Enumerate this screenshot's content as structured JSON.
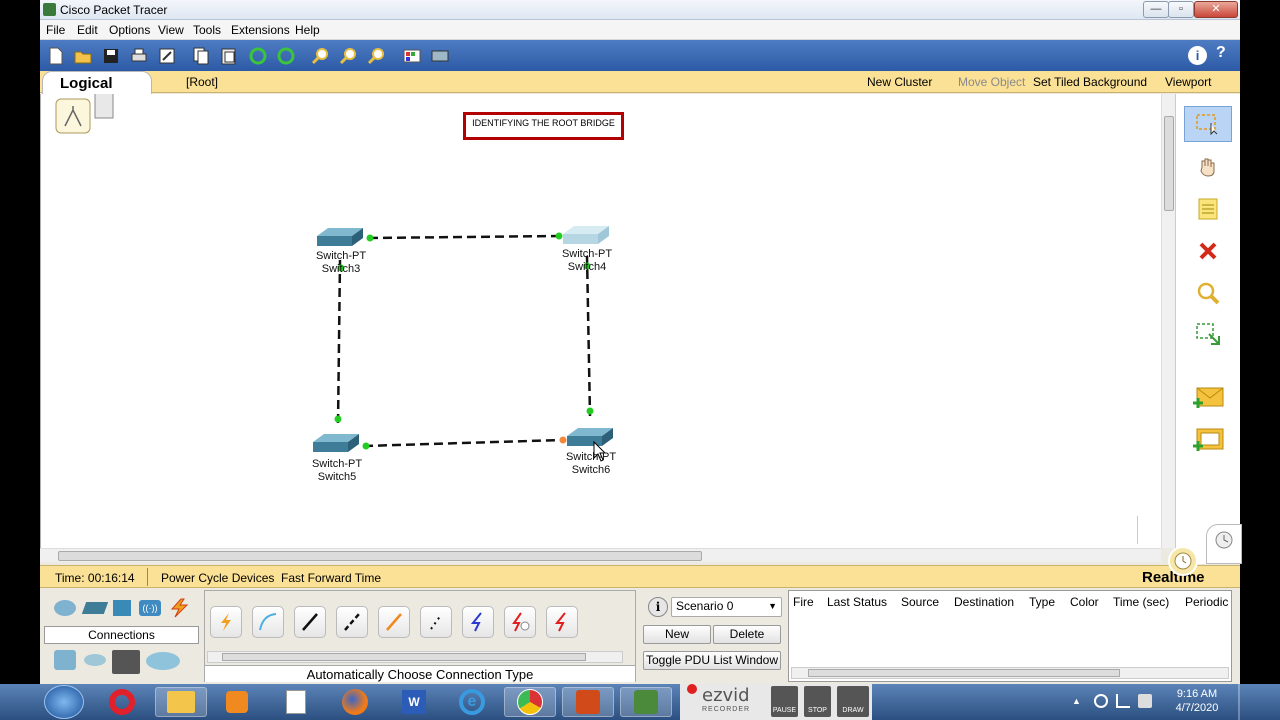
{
  "window": {
    "title": "Cisco Packet Tracer"
  },
  "menu": [
    "File",
    "Edit",
    "Options",
    "View",
    "Tools",
    "Extensions",
    "Help"
  ],
  "workspace_bar": {
    "tab_label": "Logical",
    "root_label": "[Root]",
    "new_cluster": "New Cluster",
    "move_object": "Move Object",
    "set_tiled_background": "Set Tiled Background",
    "viewport": "Viewport"
  },
  "canvas": {
    "note_text": "IDENTIFYING THE ROOT BRIDGE",
    "devices": [
      {
        "model": "Switch-PT",
        "name": "Switch3"
      },
      {
        "model": "Switch-PT",
        "name": "Switch4"
      },
      {
        "model": "Switch-PT",
        "name": "Switch5"
      },
      {
        "model": "Switch-PT",
        "name": "Switch6"
      }
    ],
    "link_colors": {
      "up": "#22cc22",
      "blocking": "#f08a3a",
      "cable": "#111111"
    }
  },
  "statusbar": {
    "time": "Time: 00:16:14",
    "power_cycle": "Power Cycle Devices",
    "fast_forward": "Fast Forward Time",
    "mode": "Realtime"
  },
  "bottom": {
    "device_category_label": "Connections",
    "connection_type_label": "Automatically Choose Connection Type",
    "scenario": {
      "selected": "Scenario 0",
      "new": "New",
      "delete": "Delete",
      "toggle_pdu": "Toggle PDU List Window"
    },
    "pdu_columns": [
      "Fire",
      "Last Status",
      "Source",
      "Destination",
      "Type",
      "Color",
      "Time (sec)",
      "Periodic"
    ]
  },
  "taskbar": {
    "time": "9:16 AM",
    "date": "4/7/2020",
    "recorder": {
      "brand": "ezvid",
      "subtitle": "RECORDER",
      "pause": "PAUSE",
      "stop": "STOP",
      "draw": "DRAW"
    }
  },
  "icons": [
    "start-orb-icon",
    "opera-icon",
    "file-explorer-icon",
    "media-player-icon",
    "document-icon",
    "firefox-icon",
    "word-icon",
    "internet-explorer-icon",
    "chrome-icon",
    "powerpoint-icon",
    "packet-tracer-icon"
  ]
}
